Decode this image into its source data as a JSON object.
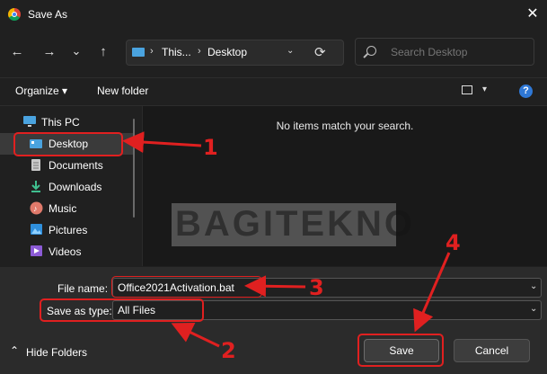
{
  "window": {
    "title": "Save As",
    "close_glyph": "✕"
  },
  "nav": {
    "back": "←",
    "forward": "→",
    "history": "⌄",
    "up": "↑"
  },
  "address": {
    "segment1": "This...",
    "segment2": "Desktop",
    "sep": "›",
    "chevron": "⌄",
    "refresh": "⟳"
  },
  "search": {
    "placeholder": "Search Desktop"
  },
  "toolbar": {
    "organize": "Organize ▾",
    "new_folder": "New folder",
    "view_chevron": "▾",
    "help": "?"
  },
  "sidebar": {
    "items": [
      {
        "label": "This PC",
        "icon": "monitor-icon"
      },
      {
        "label": "Desktop",
        "icon": "desktop-icon"
      },
      {
        "label": "Documents",
        "icon": "documents-icon"
      },
      {
        "label": "Downloads",
        "icon": "download-icon"
      },
      {
        "label": "Music",
        "icon": "music-icon"
      },
      {
        "label": "Pictures",
        "icon": "pictures-icon"
      },
      {
        "label": "Videos",
        "icon": "videos-icon"
      }
    ]
  },
  "content": {
    "empty_message": "No items match your search.",
    "watermark": "BAGITEKNO"
  },
  "form": {
    "filename_label": "File name:",
    "filename_value": "Office2021Activation.bat",
    "savetype_label": "Save as type:",
    "savetype_value": "All Files",
    "chevron": "⌄"
  },
  "footer": {
    "hide_folders": "Hide Folders",
    "hide_glyph": "⌃",
    "save": "Save",
    "cancel": "Cancel"
  },
  "annotations": {
    "n1": "1",
    "n2": "2",
    "n3": "3",
    "n4": "4",
    "color": "#e02020"
  }
}
